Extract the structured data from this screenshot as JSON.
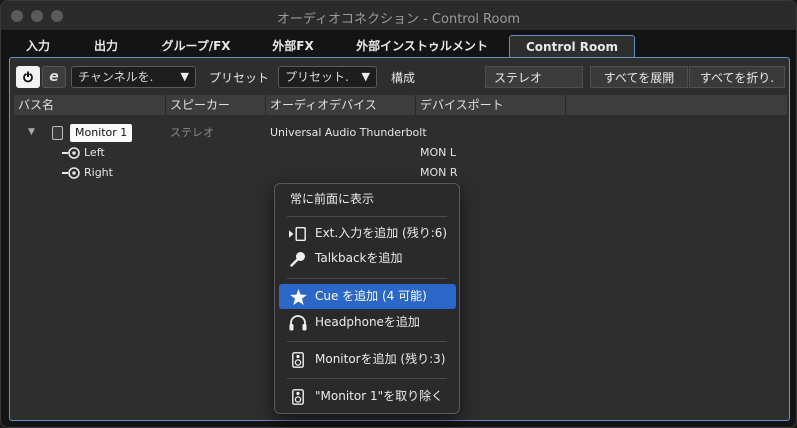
{
  "window": {
    "title": "オーディオコネクション - Control Room"
  },
  "tabs": [
    {
      "label": "入力"
    },
    {
      "label": "出力"
    },
    {
      "label": "グループ/FX"
    },
    {
      "label": "外部FX"
    },
    {
      "label": "外部インストゥルメント"
    },
    {
      "label": "Control Room",
      "active": true
    }
  ],
  "toolbar": {
    "channel_select": "チャンネルを.",
    "preset_label": "プリセット",
    "preset_select": "プリセット.",
    "config_label": "構成",
    "config_value": "ステレオ",
    "expand_all": "すべてを展開",
    "collapse_all": "すべてを折り."
  },
  "table": {
    "columns": [
      "バス名",
      "スピーカー",
      "オーディオデバイス",
      "デバイスポート"
    ],
    "bus": {
      "name": "Monitor 1",
      "speaker": "ステレオ",
      "device": "Universal Audio Thunderbolt"
    },
    "ports": [
      {
        "name": "Left",
        "port": "MON L"
      },
      {
        "name": "Right",
        "port": "MON R"
      }
    ]
  },
  "menu": {
    "always_on_top": "常に前面に表示",
    "add_ext_input": "Ext.入力を追加 (残り:6)",
    "add_talkback": "Talkbackを追加",
    "add_cue": "Cue を追加 (4 可能)",
    "add_headphone": "Headphoneを追加",
    "add_monitor": "Monitorを追加 (残り:3)",
    "remove_monitor": "\"Monitor 1\"を取り除く"
  },
  "colors": {
    "accent": "#2a67c9",
    "tab_border": "#6a8fc4"
  }
}
